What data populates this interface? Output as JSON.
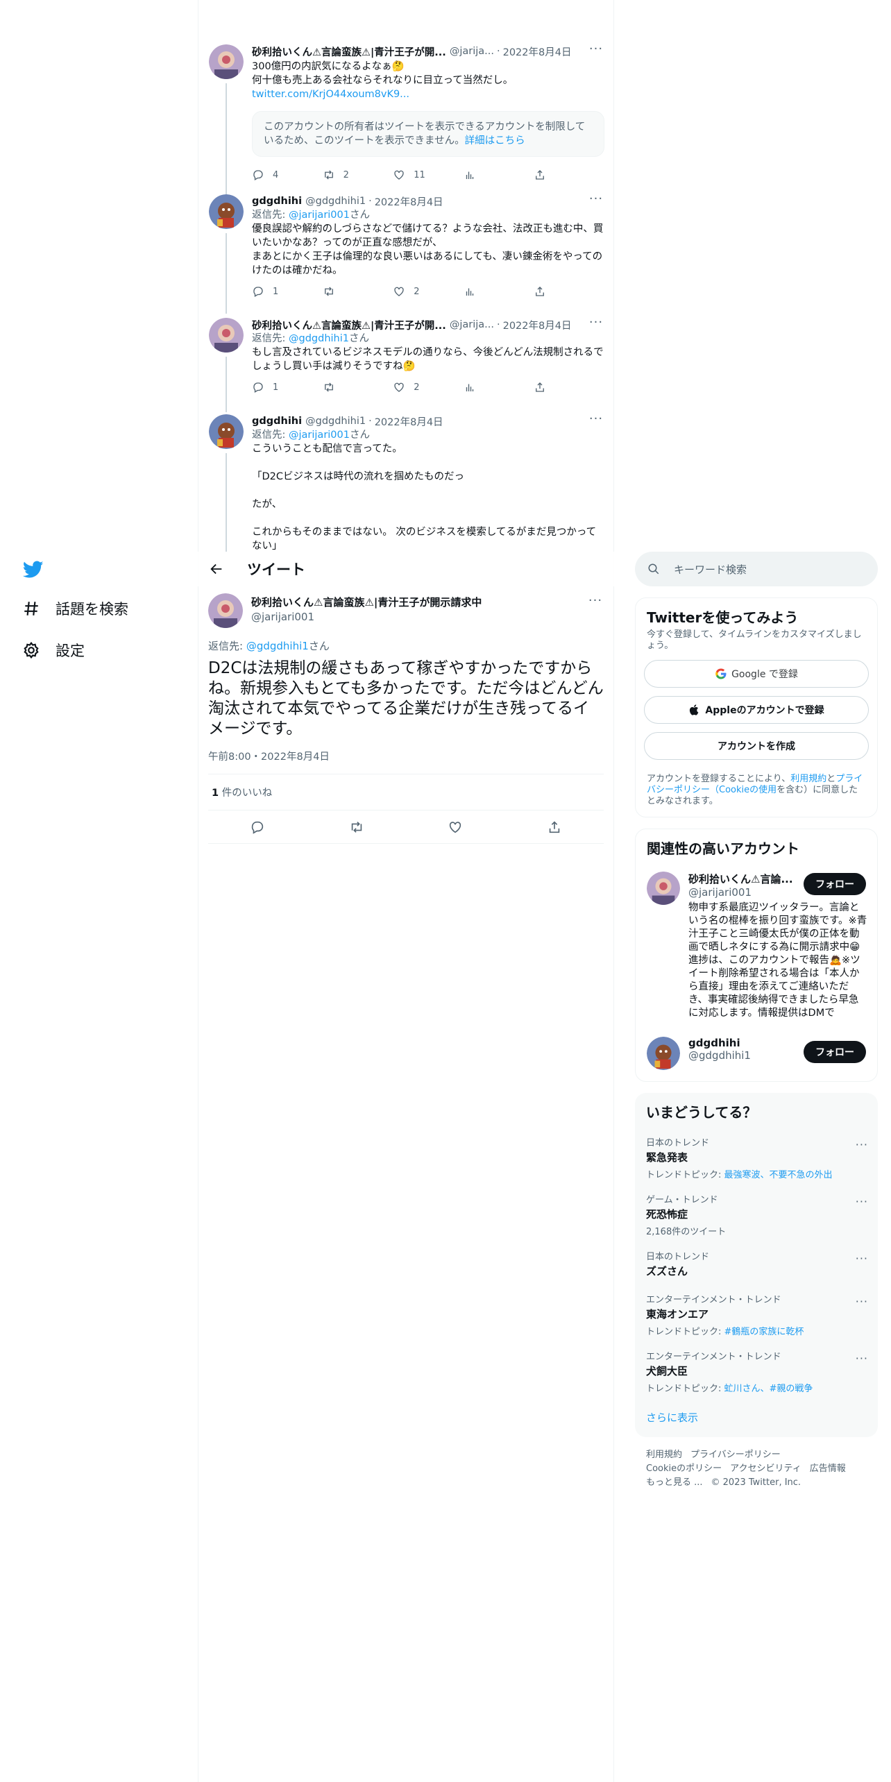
{
  "nav": {
    "explore_label": "話題を検索",
    "settings_label": "設定"
  },
  "thread": [
    {
      "name": "砂利拾いくん⚠言論蛮族⚠|青汁王子が開...",
      "handle": "@jarija...",
      "date": "2022年8月4日",
      "text_lines": [
        "300億円の内訳気になるよなぁ🤔",
        "何十億も売上ある会社ならそれなりに目立って当然だし。"
      ],
      "link": "twitter.com/KrjO44xoum8vK9...",
      "withheld": "このアカウントの所有者はツイートを表示できるアカウントを制限しているため、このツイートを表示できません。",
      "withheld_link": "詳細はこちら",
      "replies": "4",
      "retweets": "2",
      "likes": "11"
    },
    {
      "name": "gdgdhihi",
      "handle": "@gdgdhihi1",
      "date": "2022年8月4日",
      "reply_prefix": "返信先: ",
      "reply_to": "@jarijari001",
      "reply_suffix": "さん",
      "text_lines": [
        "優良誤認や解約のしづらさなどで儲けてる？ような会社、法改正も進む中、買いたいかなあ？ってのが正直な感想だが、",
        "まあとにかく王子は倫理的な良い悪いはあるにしても、凄い錬金術をやってのけたのは確かだね。"
      ],
      "replies": "1",
      "retweets": "",
      "likes": "2"
    },
    {
      "name": "砂利拾いくん⚠言論蛮族⚠|青汁王子が開...",
      "handle": "@jarija...",
      "date": "2022年8月4日",
      "reply_prefix": "返信先: ",
      "reply_to": "@gdgdhihi1",
      "reply_suffix": "さん",
      "text_lines": [
        "もし言及されているビジネスモデルの通りなら、今後どんどん法規制されるでしょうし買い手は減りそうですね🤔"
      ],
      "replies": "1",
      "retweets": "",
      "likes": "2"
    },
    {
      "name": "gdgdhihi",
      "handle": "@gdgdhihi1",
      "date": "2022年8月4日",
      "reply_prefix": "返信先: ",
      "reply_to": "@jarijari001",
      "reply_suffix": "さん",
      "text_lines": [
        "こういうことも配信で言ってた。",
        "",
        "「D2Cビジネスは時代の流れを掴めたものだっ",
        "",
        "たが、",
        "",
        "これからもそのままではない。 次のビジネスを模索してるがまだ見つかってない」"
      ]
    }
  ],
  "header": {
    "title": "ツイート"
  },
  "main_tweet": {
    "name": "砂利拾いくん⚠言論蛮族⚠|青汁王子が開示請求中",
    "handle": "@jarijari001",
    "reply_prefix": "返信先: ",
    "reply_to": "@gdgdhihi1",
    "reply_suffix": "さん",
    "text": "D2Cは法規制の緩さもあって稼ぎやすかったですからね。新規参入もとても多かったです。ただ今はどんどん淘汰されて本気でやってる企業だけが生き残ってるイメージです。",
    "timestamp": "午前8:00・2022年8月4日",
    "likes_count": "1",
    "likes_label": " 件のいいね"
  },
  "search": {
    "placeholder": "キーワード検索"
  },
  "signup": {
    "title": "Twitterを使ってみよう",
    "subtitle": "今すぐ登録して、タイムラインをカスタマイズしましょう。",
    "google_label": "Google で登録",
    "apple_label": "Appleのアカウントで登録",
    "create_label": "アカウントを作成",
    "legal_prefix": "アカウントを登録することにより、",
    "terms_link": "利用規約",
    "and": "と",
    "privacy_link": "プライバシーポリシー（Cookieの使用",
    "legal_suffix": "を含む）に同意したとみなされます。"
  },
  "relevant": {
    "title": "関連性の高いアカウント",
    "accounts": [
      {
        "name": "砂利拾いくん⚠言論...",
        "handle": "@jarijari001",
        "bio": "物申す系最底辺ツイッタラー。言論という名の棍棒を振り回す蛮族です。※青汁王子こと三崎優太氏が僕の正体を動画で晒しネタにする為に開示請求中😁進捗は、このアカウントで報告🙇※ツイート削除希望される場合は「本人から直接」理由を添えてご連絡いただき、事実確認後納得できましたら早急に対応します。情報提供はDMで",
        "follow_label": "フォロー"
      },
      {
        "name": "gdgdhihi",
        "handle": "@gdgdhihi1",
        "bio": "",
        "follow_label": "フォロー"
      }
    ]
  },
  "trends": {
    "title": "いまどうしてる？",
    "items": [
      {
        "category": "日本のトレンド",
        "name": "緊急発表",
        "meta_prefix": "トレンドトピック: ",
        "meta_link": "最強寒波、不要不急の外出",
        "meta": ""
      },
      {
        "category": "ゲーム・トレンド",
        "name": "死恐怖症",
        "meta_prefix": "",
        "meta_link": "",
        "meta": "2,168件のツイート"
      },
      {
        "category": "日本のトレンド",
        "name": "ズズさん",
        "meta_prefix": "",
        "meta_link": "",
        "meta": ""
      },
      {
        "category": "エンターテインメント・トレンド",
        "name": "東海オンエア",
        "meta_prefix": "トレンドトピック: ",
        "meta_link": "#鶴瓶の家族に乾杯",
        "meta": ""
      },
      {
        "category": "エンターテインメント・トレンド",
        "name": "犬飼大臣",
        "meta_prefix": "トレンドトピック: ",
        "meta_link": "虻川さん、#親の戦争",
        "meta": ""
      }
    ],
    "show_more": "さらに表示"
  },
  "footer": {
    "terms": "利用規約",
    "privacy": "プライバシーポリシー",
    "cookies": "Cookieのポリシー",
    "accessibility": "アクセシビリティ",
    "ads": "広告情報",
    "more": "もっと見る ...",
    "copyright": "© 2023 Twitter, Inc."
  },
  "colors": {
    "accent": "#1d9bf0",
    "text": "#0f1419",
    "muted": "#536471",
    "border": "#eff3f4"
  }
}
